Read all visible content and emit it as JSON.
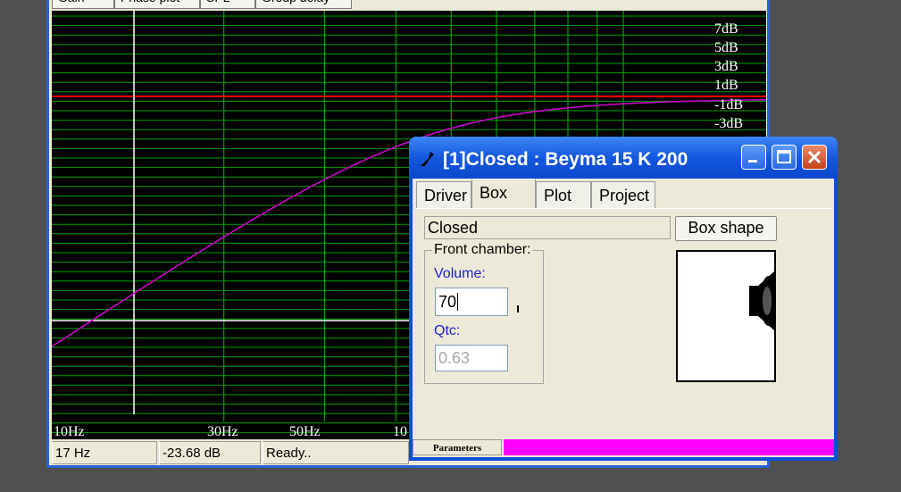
{
  "main_window": {
    "top_tabs": [
      "Gain",
      "Phase plot",
      "SPL",
      "Group delay"
    ]
  },
  "plot": {
    "db_labels": [
      "7dB",
      "5dB",
      "3dB",
      "1dB",
      "-1dB",
      "-3dB"
    ],
    "hz_labels": [
      "10Hz",
      "30Hz",
      "50Hz",
      "10"
    ],
    "colors": {
      "background": "#000000",
      "grid": "#00a000",
      "reference": "#ff0000",
      "curve": "#cc00cc",
      "cursor": "#ffffff"
    }
  },
  "status_bar": {
    "frequency": "17 Hz",
    "level": "-23.68 dB",
    "message": "Ready.."
  },
  "dialog": {
    "title": "[1]Closed : Beyma 15 K 200",
    "tabs": [
      "Driver",
      "Box",
      "Plot",
      "Project"
    ],
    "active_tab": "Box",
    "box_type": "Closed",
    "box_shape_button": "Box shape",
    "front_chamber_label": "Front chamber:",
    "volume_label": "Volume:",
    "volume_value": "70",
    "qtc_label": "Qtc:",
    "qtc_value": "0.63",
    "status_label": "Parameters",
    "progress": 1.0
  }
}
